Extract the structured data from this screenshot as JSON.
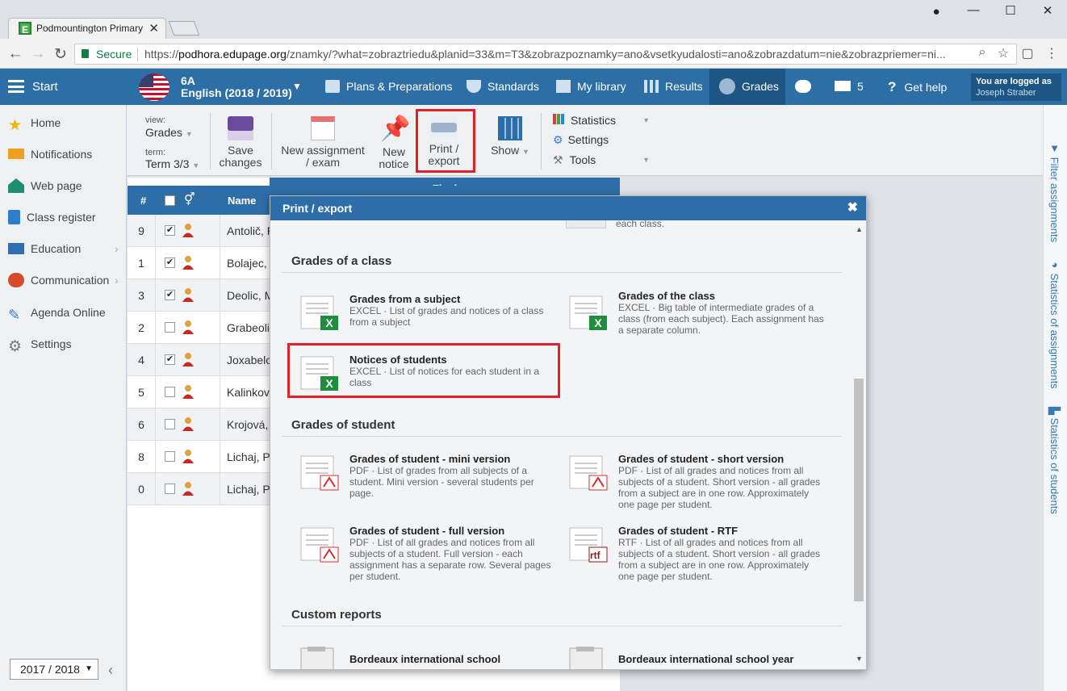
{
  "browser": {
    "tab_title": "Podmountington Primary",
    "secure_label": "Secure",
    "url_prefix": "https://",
    "url_host": "podhora.edupage.org",
    "url_path": "/znamky/?what=zobraztriedu&planid=33&m=T3&zobrazpoznamky=ano&vsetkyudalosti=ano&zobrazdatum=nie&zobrazpriemer=ni..."
  },
  "topnav": {
    "start": "Start",
    "class_code": "6A",
    "class_subject": "English (2018 / 2019)",
    "plans": "Plans & Preparations",
    "standards": "Standards",
    "library": "My library",
    "results": "Results",
    "grades": "Grades",
    "messages_count": "5",
    "help": "Get help",
    "logged_label": "You are logged as",
    "user": "Joseph Straber"
  },
  "sidebar": {
    "items": [
      {
        "label": "Home",
        "icon": "star-icon"
      },
      {
        "label": "Notifications",
        "icon": "envelope-icon"
      },
      {
        "label": "Web page",
        "icon": "house-icon"
      },
      {
        "label": "Class register",
        "icon": "book-icon"
      },
      {
        "label": "Education",
        "icon": "open-book-icon"
      },
      {
        "label": "Communication",
        "icon": "chat-icon"
      },
      {
        "label": "Agenda Online",
        "icon": "pen-icon"
      },
      {
        "label": "Settings",
        "icon": "gear-icon"
      }
    ],
    "year": "2017 / 2018"
  },
  "toolbar": {
    "view_label": "view:",
    "view_value": "Grades",
    "term_label": "term:",
    "term_value": "Term 3/3",
    "save": [
      "Save",
      "changes"
    ],
    "new_assignment": [
      "New assignment",
      "/ exam"
    ],
    "new_notice": [
      "New",
      "notice"
    ],
    "print": [
      "Print /",
      "export"
    ],
    "show": "Show",
    "statistics": "Statistics",
    "settings": "Settings",
    "tools": "Tools"
  },
  "rail": {
    "filter": "Filter assignments",
    "stats_assign": "Statistics of assignments",
    "stats_students": "Statistics of students"
  },
  "grid": {
    "final": "Final",
    "col_num": "#",
    "col_name": "Name",
    "rows": [
      {
        "num": "9",
        "checked": true,
        "name": "Antolič, F"
      },
      {
        "num": "1",
        "checked": true,
        "name": "Bolajec, C"
      },
      {
        "num": "3",
        "checked": true,
        "name": "Deolic, M"
      },
      {
        "num": "2",
        "checked": false,
        "name": "Grabeolić"
      },
      {
        "num": "4",
        "checked": true,
        "name": "Joxabelo"
      },
      {
        "num": "5",
        "checked": false,
        "name": "Kalinkova"
      },
      {
        "num": "6",
        "checked": false,
        "name": "Krojová,"
      },
      {
        "num": "8",
        "checked": false,
        "name": "Lichaj, Pe"
      },
      {
        "num": "0",
        "checked": false,
        "name": "Lichaj, Pe"
      }
    ]
  },
  "modal": {
    "title": "Print / export",
    "top_cut_text": "each class.",
    "sections": {
      "class": "Grades of a class",
      "student": "Grades of student",
      "custom": "Custom reports"
    },
    "items": {
      "subject": {
        "title": "Grades from a subject",
        "desc": "EXCEL · List of grades and notices of a class from a subject"
      },
      "class": {
        "title": "Grades of the class",
        "desc": "EXCEL · Big table of intermediate grades of a class (from each subject). Each assignment has a separate column."
      },
      "notices": {
        "title": "Notices of students",
        "desc": "EXCEL · List of notices for each student in a class"
      },
      "mini": {
        "title": "Grades of student - mini version",
        "desc": "PDF · List of grades from all subjects of a student. Mini version - several students per page."
      },
      "short": {
        "title": "Grades of student - short version",
        "desc": "PDF · List of all grades and notices from all subjects of a student. Short version - all grades from a subject are in one row. Approximately one page per student."
      },
      "full": {
        "title": "Grades of student - full version",
        "desc": "PDF · List of all grades and notices from all subjects of a student. Full version - each assignment has a separate row. Several pages per student."
      },
      "rtf": {
        "title": "Grades of student - RTF",
        "desc": "RTF · List of all grades and notices from all subjects of a student. Short version - all grades from a subject are in one row. Approximately one page per student."
      },
      "bordeaux1": {
        "title": "Bordeaux international school"
      },
      "bordeaux2": {
        "title": "Bordeaux international school year"
      }
    },
    "rtf_badge": "rtf"
  },
  "colors": {
    "nav": "#2c6fa6",
    "highlight": "#e0202a",
    "excel": "#1e8e3e",
    "pdf": "#d32f2f"
  }
}
